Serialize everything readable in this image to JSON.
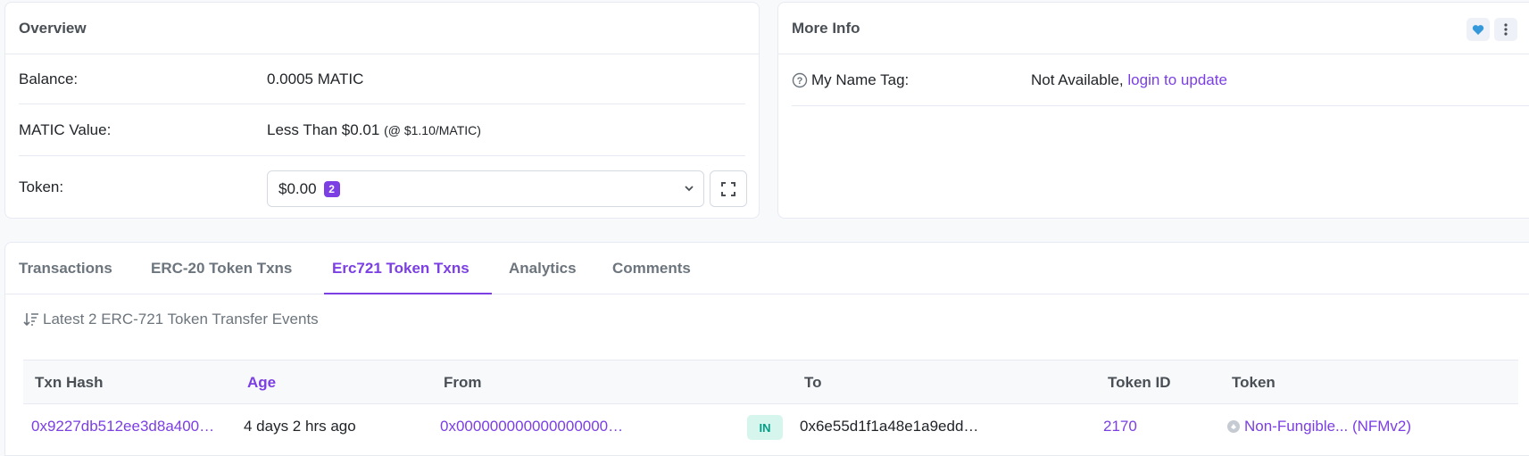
{
  "overview": {
    "title": "Overview",
    "balance_label": "Balance:",
    "balance_value": "0.0005 MATIC",
    "value_label": "MATIC Value:",
    "value_value": "Less Than $0.01",
    "value_rate": "(@ $1.10/MATIC)",
    "token_label": "Token:",
    "token_value": "$0.00",
    "token_count": "2"
  },
  "more_info": {
    "title": "More Info",
    "name_tag_label": "My Name Tag:",
    "name_tag_value": "Not Available,",
    "name_tag_link": "login to update"
  },
  "tabs": [
    {
      "label": "Transactions"
    },
    {
      "label": "ERC-20 Token Txns"
    },
    {
      "label": "Erc721 Token Txns"
    },
    {
      "label": "Analytics"
    },
    {
      "label": "Comments"
    }
  ],
  "events": {
    "summary": "Latest 2 ERC-721 Token Transfer Events"
  },
  "table": {
    "headers": {
      "txn_hash": "Txn Hash",
      "age": "Age",
      "from": "From",
      "to": "To",
      "token_id": "Token ID",
      "token": "Token"
    },
    "rows": [
      {
        "txn_hash": "0x9227db512ee3d8a400…",
        "age": "4 days 2 hrs ago",
        "from": "0x000000000000000000…",
        "direction": "IN",
        "to": "0x6e55d1f1a48e1a9edd…",
        "token_id": "2170",
        "token": "Non-Fungible... (NFMv2)"
      }
    ]
  },
  "colors": {
    "accent": "#7b3fe4",
    "in_badge_bg": "#d6f5ec",
    "in_badge_text": "#00a186",
    "heart": "#3498db"
  }
}
